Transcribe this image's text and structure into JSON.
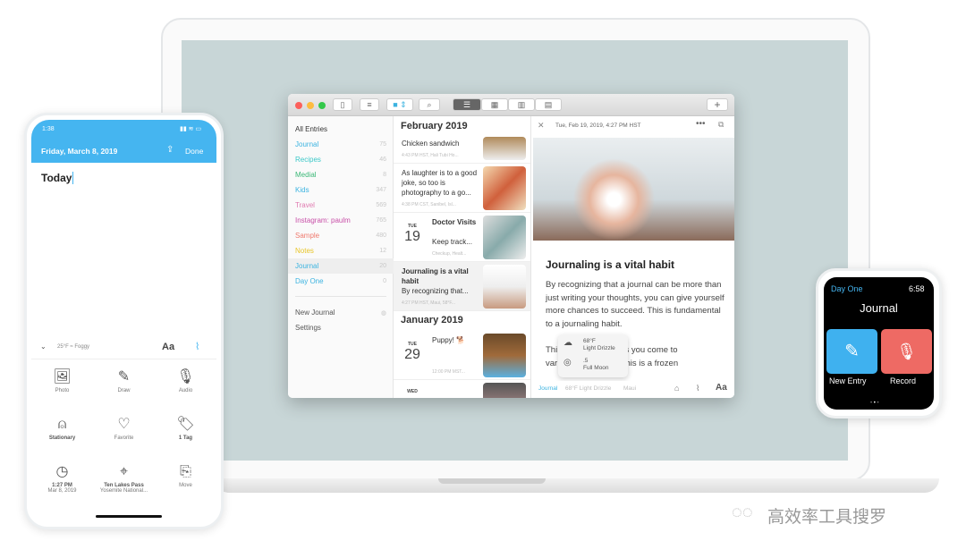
{
  "mac": {
    "toolbar": {
      "sidebar_icon": "sidebar-icon",
      "filter_icon": "filter-icon",
      "search_icon": "search-icon",
      "views": [
        "list-view",
        "grid-view",
        "timeline-view",
        "calendar-view"
      ],
      "add": "+"
    },
    "sidebar": {
      "items": [
        {
          "label": "All Entries",
          "count": "",
          "color": "#333333"
        },
        {
          "label": "Journal",
          "count": "75",
          "color": "#3bb3e0"
        },
        {
          "label": "Recipes",
          "count": "46",
          "color": "#3cc8c8"
        },
        {
          "label": "Medial",
          "count": "8",
          "color": "#3cb878"
        },
        {
          "label": "Kids",
          "count": "347",
          "color": "#3bb3e0"
        },
        {
          "label": "Travel",
          "count": "569",
          "color": "#e07ab0"
        },
        {
          "label": "Instagram: paulm",
          "count": "765",
          "color": "#c84fa8"
        },
        {
          "label": "Sample",
          "count": "480",
          "color": "#ef7a6e"
        },
        {
          "label": "Notes",
          "count": "12",
          "color": "#e8c528"
        },
        {
          "label": "Journal",
          "count": "20",
          "color": "#3bb3e0"
        },
        {
          "label": "Day One",
          "count": "0",
          "color": "#3bb3e0"
        }
      ],
      "new_journal": "New Journal",
      "settings": "Settings"
    },
    "list": {
      "months": [
        "February 2019",
        "January 2019"
      ],
      "entries": [
        {
          "title": "Chicken sandwich",
          "meta": "4:43 PM HST, Hali Tubi Ho..."
        },
        {
          "title": "As laughter is to a good joke, so too is photography to a go...",
          "meta": "4:38 PM CST, Sanibel, Isl..."
        },
        {
          "dow": "TUE",
          "day": "19",
          "title": "Doctor Visits",
          "body": "Keep track...",
          "meta": "Checkup, Healt..."
        },
        {
          "title": "Journaling is a vital habit",
          "body": "By recognizing that...",
          "meta": "4:27 PM HST, Maui, 58°F..."
        },
        {
          "dow": "TUE",
          "day": "29",
          "title": "Puppy! 🐕",
          "meta": "12:00 PM MST..."
        },
        {
          "dow": "WED",
          "day": "",
          "title": "",
          "meta": ""
        }
      ]
    },
    "detail": {
      "date": "Tue, Feb 19, 2019, 4:27 PM HST",
      "title": "Journaling is a vital habit",
      "body": "By recognizing that a journal can be more than just writing your thoughts, you can give yourself more chances to succeed. This is fundamental to a journaling habit.",
      "body2a": "Thi",
      "body2b": "day as you come to",
      "body3a": "var",
      "body3b": "That this is a frozen",
      "popup": {
        "temp": "68°F",
        "weather": "Light Drizzle",
        "moon_value": ".5",
        "moon": "Full Moon"
      },
      "footer": {
        "journal": "Journal",
        "weather": "68°F Light Drizzle",
        "location": "Maui",
        "aa": "Aa"
      }
    }
  },
  "phone": {
    "time": "1:38",
    "date": "Friday, March 8, 2019",
    "done": "Done",
    "title": "Today",
    "weather": "25°F ≈ Foggy",
    "aa": "Aa",
    "grid": [
      {
        "icon": "photo-icon",
        "glyph": "🖼",
        "label": "Photo"
      },
      {
        "icon": "draw-icon",
        "glyph": "✎",
        "label": "Draw"
      },
      {
        "icon": "microphone-icon",
        "glyph": "🎙",
        "label": "Audio"
      },
      {
        "icon": "stationary-icon",
        "glyph": "⍝",
        "label": "Stationary"
      },
      {
        "icon": "heart-icon",
        "glyph": "♡",
        "label": "Favorite"
      },
      {
        "icon": "tag-icon",
        "glyph": "🏷",
        "label": "1 Tag"
      },
      {
        "icon": "clock-icon",
        "glyph": "◷",
        "label": "1:27 PM",
        "sub": "Mar 8, 2019"
      },
      {
        "icon": "location-pin-icon",
        "glyph": "⌖",
        "label": "Ten Lakes Pass",
        "sub": "Yosemite National..."
      },
      {
        "icon": "move-icon",
        "glyph": "⎘",
        "label": "Move"
      }
    ]
  },
  "watch": {
    "app": "Day One",
    "time": "6:58",
    "journal": "Journal",
    "new_entry": "New Entry",
    "record": "Record",
    "colors": {
      "new_entry": "#3fb1ef",
      "record": "#ee6a64"
    }
  },
  "watermark": {
    "text": "高效率工具搜罗"
  }
}
